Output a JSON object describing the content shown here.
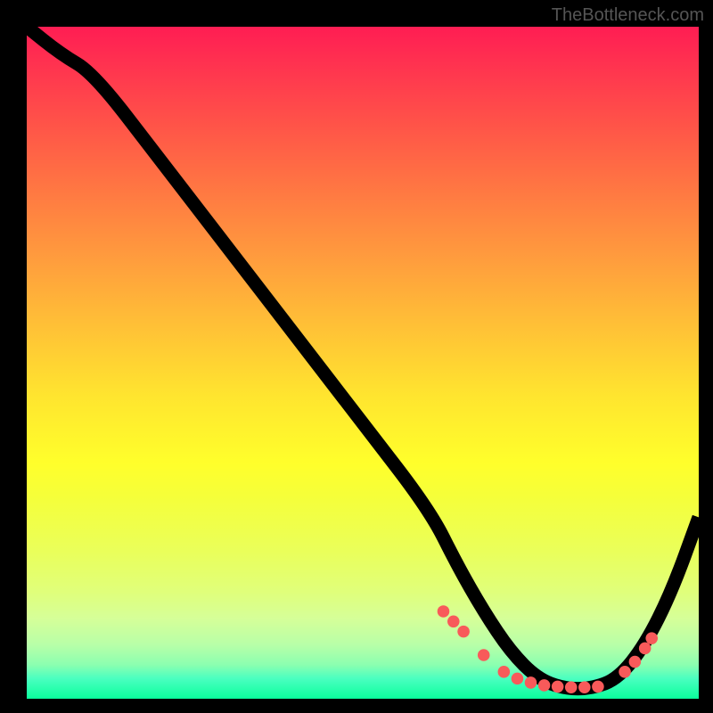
{
  "watermark": "TheBottleneck.com",
  "chart_data": {
    "type": "line",
    "title": "",
    "xlabel": "",
    "ylabel": "",
    "xlim": [
      0,
      100
    ],
    "ylim": [
      0,
      100
    ],
    "series": [
      {
        "name": "curve",
        "x": [
          0,
          5,
          10,
          20,
          30,
          40,
          50,
          60,
          64,
          68,
          72,
          76,
          80,
          84,
          88,
          92,
          96,
          100
        ],
        "y": [
          100,
          96,
          93,
          80,
          67,
          54,
          41,
          28,
          20,
          13,
          7,
          3,
          1.5,
          1.5,
          3,
          8,
          16,
          27
        ]
      }
    ],
    "dots": {
      "x": [
        62,
        63.5,
        65,
        68,
        71,
        73,
        75,
        77,
        79,
        81,
        83,
        85,
        89,
        90.5,
        92,
        93
      ],
      "y": [
        13,
        11.5,
        10,
        6.5,
        4,
        3,
        2.4,
        2,
        1.8,
        1.7,
        1.7,
        1.8,
        4,
        5.5,
        7.5,
        9
      ]
    },
    "gradient_colors": {
      "top": "#ff1d53",
      "middle": "#ffff2b",
      "bottom": "#0aff9c"
    }
  }
}
